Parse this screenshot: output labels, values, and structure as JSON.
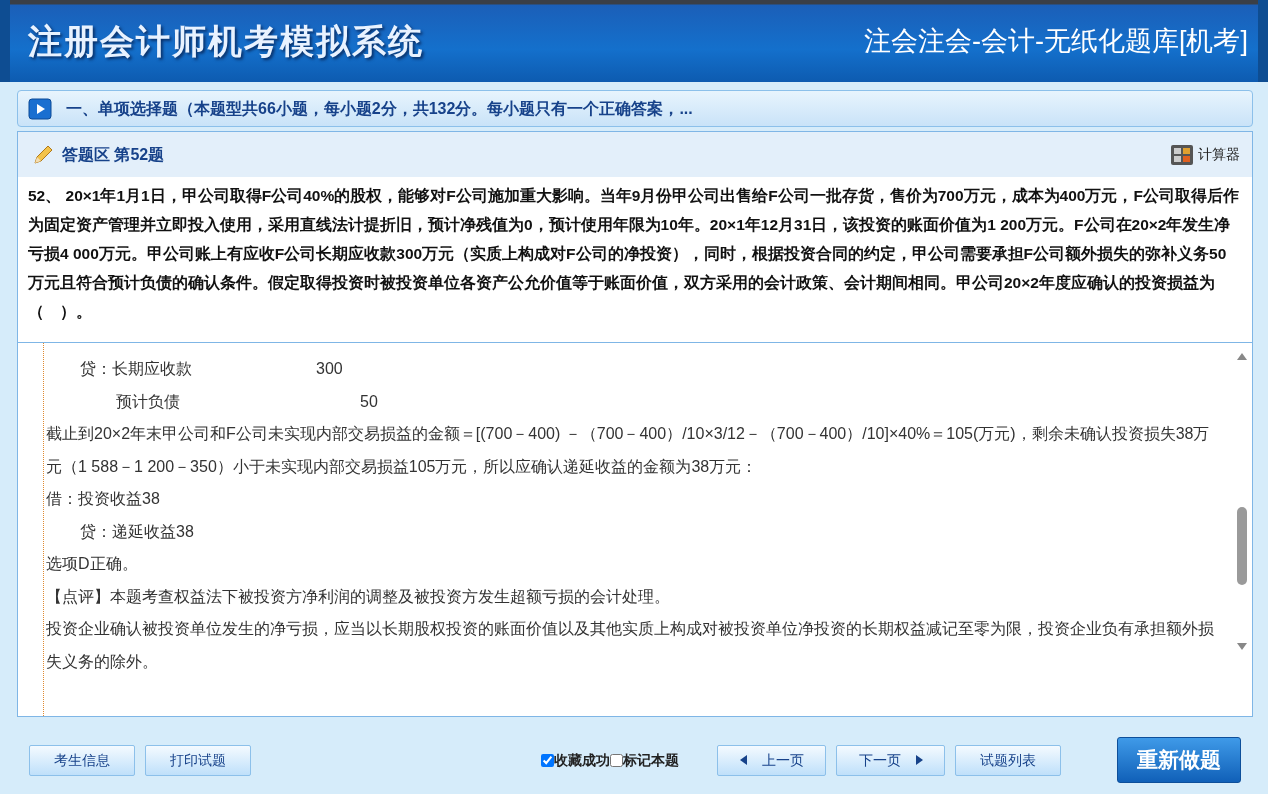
{
  "header": {
    "title": "注册会计师机考模拟系统",
    "subtitle": "注会注会-会计-无纸化题库[机考]"
  },
  "section": {
    "title": "一、单项选择题（本题型共66小题，每小题2分，共132分。每小题只有一个正确答案，..."
  },
  "answer_area": {
    "title": "答题区 第52题",
    "calculator": "计算器"
  },
  "question": {
    "text": "52、 20×1年1月1日，甲公司取得F公司40%的股权，能够对F公司施加重大影响。当年9月份甲公司出售给F公司一批存货，售价为700万元，成本为400万元，F公司取得后作为固定资产管理并立即投入使用，采用直线法计提折旧，预计净残值为0，预计使用年限为10年。20×1年12月31日，该投资的账面价值为1 200万元。F公司在20×2年发生净亏损4 000万元。甲公司账上有应收F公司长期应收款300万元（实质上构成对F公司的净投资），同时，根据投资合同的约定，甲公司需要承担F公司额外损失的弥补义务50万元且符合预计负债的确认条件。假定取得投资时被投资单位各资产公允价值等于账面价值，双方采用的会计政策、会计期间相同。甲公司20×2年度应确认的投资损益为（　）。"
  },
  "explanation": [
    {
      "kind": "credit",
      "label": "贷：长期应收款",
      "amount": "300"
    },
    {
      "kind": "credit-sub",
      "label": "预计负债",
      "amount": "50"
    },
    {
      "kind": "text",
      "text": "截止到20×2年末甲公司和F公司未实现内部交易损益的金额＝[(700－400) －（700－400）/10×3/12－（700－400）/10]×40%＝105(万元)，剩余未确认投资损失38万元（1 588－1 200－350）小于未实现内部交易损益105万元，所以应确认递延收益的金额为38万元："
    },
    {
      "kind": "text",
      "text": "借：投资收益38"
    },
    {
      "kind": "credit",
      "label": "贷：递延收益38"
    },
    {
      "kind": "text",
      "text": "选项D正确。"
    },
    {
      "kind": "text",
      "text": "【点评】本题考查权益法下被投资方净利润的调整及被投资方发生超额亏损的会计处理。"
    },
    {
      "kind": "text",
      "text": "投资企业确认被投资单位发生的净亏损，应当以长期股权投资的账面价值以及其他实质上构成对被投资单位净投资的长期权益减记至零为限，投资企业负有承担额外损失义务的除外。"
    }
  ],
  "footer": {
    "left_buttons": [
      "考生信息",
      "打印试题"
    ],
    "checks": [
      {
        "label": "收藏成功",
        "checked": true
      },
      {
        "label": "标记本题",
        "checked": false
      }
    ],
    "prev": "上一页",
    "next": "下一页",
    "list": "试题列表",
    "redo": "重新做题"
  }
}
